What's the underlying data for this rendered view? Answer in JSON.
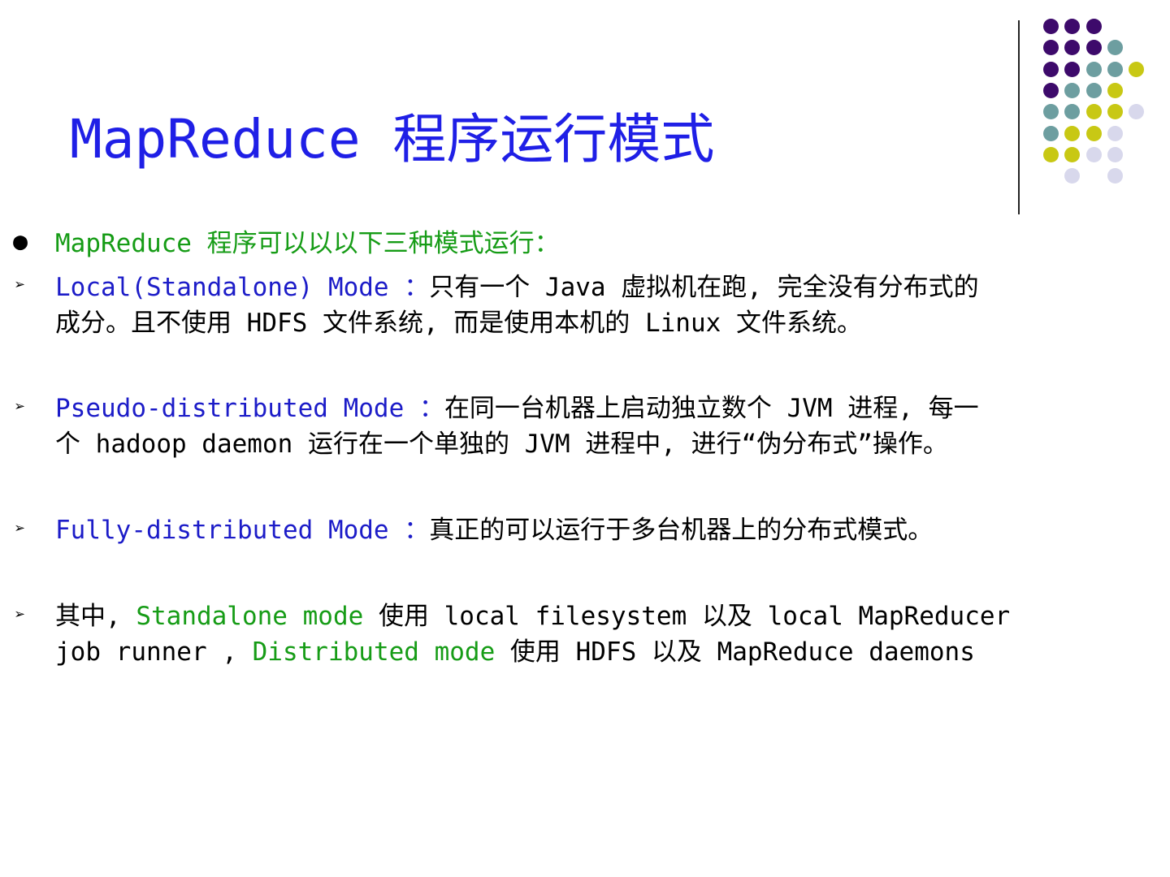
{
  "slide": {
    "title": "MapReduce 程序运行模式",
    "colors": {
      "title": "#1f1fe6",
      "green_text": "#169c16",
      "blue_text": "#1c1cc8",
      "dot_purple": "#3d0a6b",
      "dot_teal": "#6d9ea0",
      "dot_yellow": "#c8c814",
      "dot_lavender": "#d8d8ec"
    },
    "intro": {
      "bullet_icon": "filled-circle-bullet-icon",
      "text": "MapReduce 程序可以以以下三种模式运行："
    },
    "items": [
      {
        "bullet_icon": "arrowhead-bullet-icon",
        "mode": "Local(Standalone) Mode ：",
        "line1": "只有一个 Java  虚拟机在跑, 完全没有分布式的",
        "line2": "成分。且不使用 HDFS 文件系统, 而是使用本机的 Linux 文件系统。"
      },
      {
        "bullet_icon": "arrowhead-bullet-icon",
        "mode": "Pseudo-distributed Mode ：",
        "line1": "在同一台机器上启动独立数个 JVM  进程, 每一",
        "line2": "个 hadoop daemon 运行在一个单独的 JVM 进程中, 进行“伪分布式”操作。"
      },
      {
        "bullet_icon": "arrowhead-bullet-icon",
        "mode": "Fully-distributed Mode ：",
        "line1": "真正的可以运行于多台机器上的分布式模式。"
      },
      {
        "bullet_icon": "arrowhead-bullet-icon",
        "prefix": "其中,  ",
        "mode_a": "Standalone mode",
        "mid_a": "  使用 local filesystem  以及 local MapReducer",
        "line2_start": "job runner ,  ",
        "mode_b": "Distributed mode",
        "line2_end": "  使用 HDFS  以及 MapReduce daemons"
      }
    ]
  }
}
